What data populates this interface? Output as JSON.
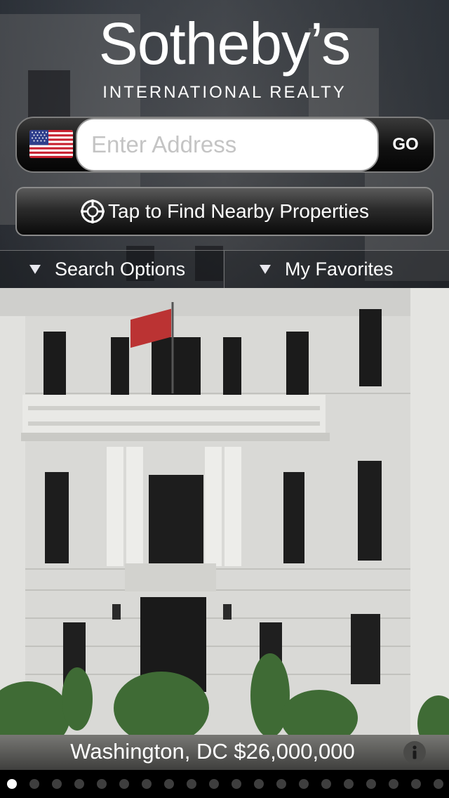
{
  "brand": {
    "name": "Sotheby’s",
    "subtitle": "INTERNATIONAL REALTY"
  },
  "search": {
    "country_icon": "us-flag-icon",
    "placeholder": "Enter Address",
    "value": "",
    "go_label": "GO"
  },
  "nearby": {
    "icon": "crosshair-icon",
    "label": "Tap to Find Nearby Properties"
  },
  "tabs": [
    {
      "label": "Search Options",
      "icon": "triangle-down-icon"
    },
    {
      "label": "My Favorites",
      "icon": "triangle-down-icon"
    }
  ],
  "featured": {
    "caption": "Washington, DC $26,000,000",
    "info_icon": "info-icon"
  },
  "pager": {
    "count": 20,
    "active_index": 0
  },
  "colors": {
    "button_dark": "#111111",
    "text_light": "#ffffff",
    "placeholder": "#c4c4c4",
    "dot_inactive": "#3e3e3e"
  }
}
